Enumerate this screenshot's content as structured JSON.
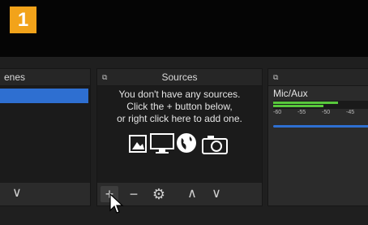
{
  "step": {
    "number": "1",
    "color": "#f2a31a"
  },
  "docks": {
    "scenes": {
      "title": "enes",
      "footer_icon": "chevron-down-icon"
    },
    "sources": {
      "title": "Sources",
      "empty_line1": "You don't have any sources.",
      "empty_line2": "Click the + button below,",
      "empty_line3": "or right click here to add one.",
      "empty_icons": [
        "image-icon",
        "monitor-icon",
        "globe-icon",
        "camera-icon"
      ],
      "footer_buttons": [
        "add-icon",
        "remove-icon",
        "gear-icon",
        "chevron-up-icon",
        "chevron-down-icon"
      ]
    },
    "mixer": {
      "channel": "Mic/Aux",
      "ticks": [
        "-60",
        "-55",
        "-50",
        "-45"
      ],
      "level_top": 0.67,
      "level_bottom": 0.52
    }
  },
  "colors": {
    "selection": "#2e6fd1",
    "meter_green": "#58c83c",
    "panel": "#2b2b2b",
    "background": "#1f1f1f"
  }
}
